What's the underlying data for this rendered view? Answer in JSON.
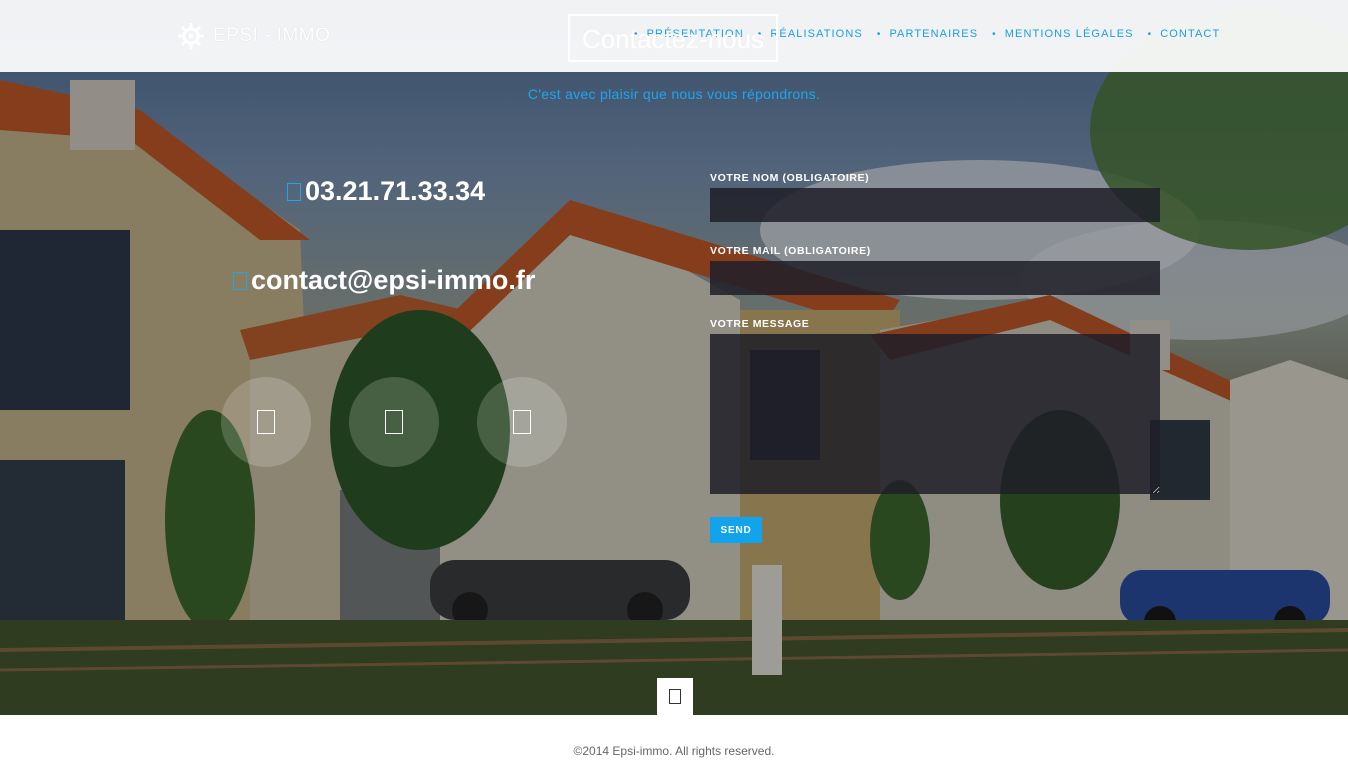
{
  "header": {
    "logo_text": "EPSI - IMMO",
    "nav": [
      {
        "label": "PRÉSENTATION"
      },
      {
        "label": "RÉALISATIONS"
      },
      {
        "label": "PARTENAIRES"
      },
      {
        "label": "MENTIONS LÉGALES"
      },
      {
        "label": "CONTACT"
      }
    ]
  },
  "section": {
    "title": "Contactez-nous",
    "subtitle": "C'est avec plaisir que nous vous répondrons."
  },
  "contact": {
    "phone": "03.21.71.33.34",
    "email": "contact@epsi-immo.fr",
    "phone_icon": "phone-icon",
    "email_icon": "envelope-icon",
    "social_icons": [
      "facebook-icon",
      "twitter-icon",
      "google-plus-icon"
    ]
  },
  "form": {
    "name_label": "VOTRE NOM (OBLIGATOIRE)",
    "name_value": "",
    "mail_label": "VOTRE MAIL (OBLIGATOIRE)",
    "mail_value": "",
    "message_label": "VOTRE MESSAGE",
    "message_value": "",
    "send_label": "SEND"
  },
  "footer": {
    "copyright": "©2014 Epsi-immo. All rights reserved."
  },
  "colors": {
    "accent": "#1ea5f0",
    "button": "#11a3ec",
    "field_bg": "#1e1e28"
  }
}
